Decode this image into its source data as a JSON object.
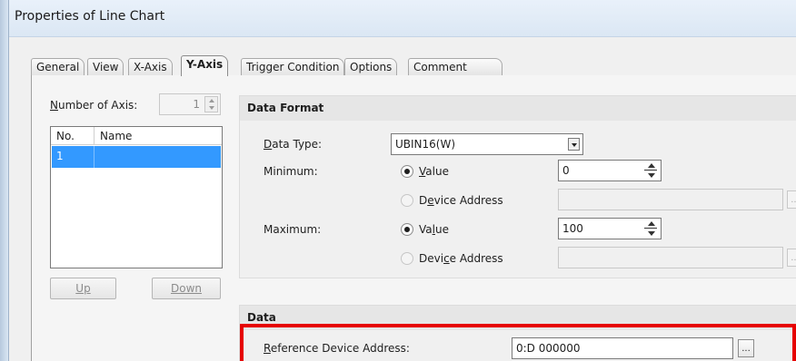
{
  "window": {
    "title": "Properties of Line Chart"
  },
  "tabs": [
    {
      "label": "General",
      "active": false
    },
    {
      "label": "View",
      "active": false
    },
    {
      "label": "X-Axis",
      "active": false
    },
    {
      "label": "Y-Axis",
      "active": true
    },
    {
      "label": "Trigger Condition",
      "active": false
    },
    {
      "label": "Options",
      "active": false
    },
    {
      "label": "Comment",
      "active": false
    }
  ],
  "axis": {
    "number_label": "Number of Axis:",
    "number_value": "1",
    "list_headers": [
      "No.",
      "Name"
    ],
    "rows": [
      {
        "no": "1",
        "name": ""
      }
    ],
    "up_label": "Up",
    "down_label": "Down"
  },
  "data_format": {
    "heading": "Data Format",
    "data_type_label": "Data Type:",
    "data_type_value": "UBIN16(W)",
    "minimum_label": "Minimum:",
    "maximum_label": "Maximum:",
    "value_option": "Value",
    "device_option": "Device Address",
    "min_value": "0",
    "max_value": "100",
    "min_selected": "Value",
    "max_selected": "Value"
  },
  "data": {
    "heading": "Data",
    "ref_label": "Reference Device Address:",
    "ref_value": "0:D 000000",
    "browse": "..."
  },
  "colors": {
    "highlight": "#e60000",
    "selection": "#3399ff"
  }
}
